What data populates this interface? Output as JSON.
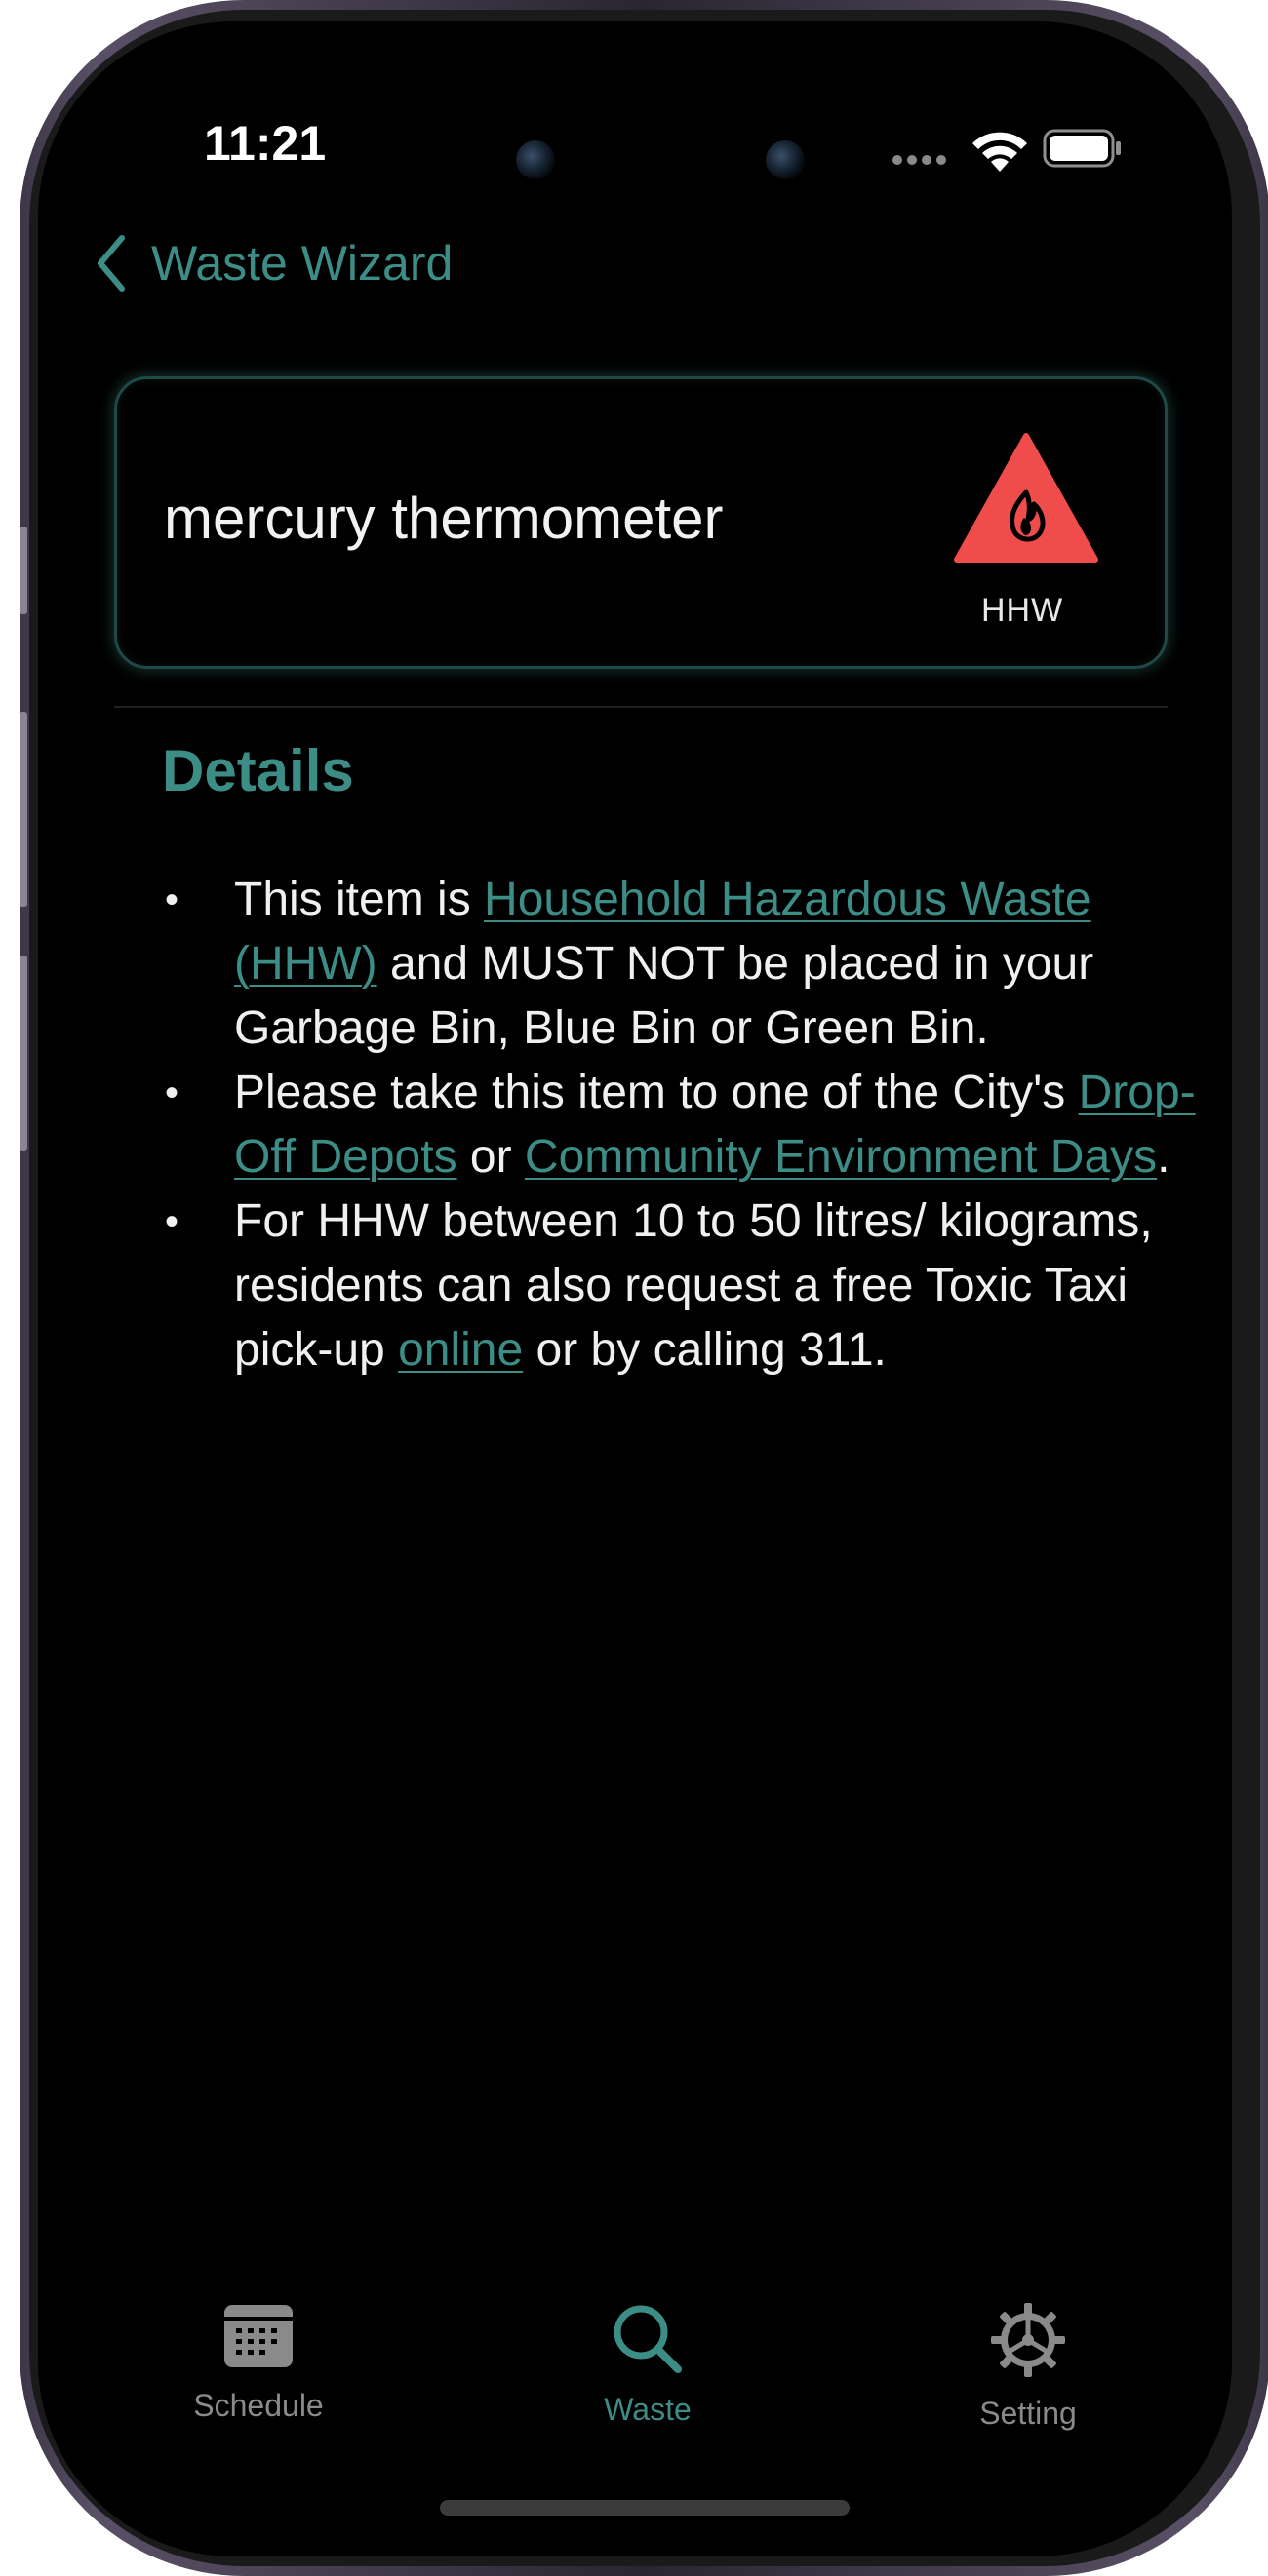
{
  "status_bar": {
    "time": "11:21"
  },
  "nav": {
    "back_label": "Waste Wizard"
  },
  "item": {
    "title": "mercury thermometer",
    "category_label": "HHW",
    "category_icon": "hazard-flame-icon",
    "category_color": "#f04c4c"
  },
  "details": {
    "heading": "Details",
    "bullet1": {
      "pre": "This item is ",
      "link": "Household Hazardous Waste (HHW)",
      "post": " and MUST NOT be placed in your Garbage Bin, Blue Bin or Green Bin."
    },
    "bullet2": {
      "pre": "Please take this item to one of the City's ",
      "link1": "Drop-Off Depots",
      "mid": " or ",
      "link2": "Community Environment Days",
      "post": "."
    },
    "bullet3": {
      "pre": "For HHW between 10 to 50 litres/ kilograms, residents can also request a free Toxic Taxi pick-up ",
      "link": "online",
      "post": " or by calling 311."
    }
  },
  "tabs": [
    {
      "label": "Schedule",
      "icon": "calendar-icon",
      "active": false
    },
    {
      "label": "Waste",
      "icon": "search-icon",
      "active": true
    },
    {
      "label": "Setting",
      "icon": "gear-icon",
      "active": false
    }
  ],
  "colors": {
    "accent": "#3d8d87",
    "background": "#000000",
    "inactive": "#8a8a8a"
  }
}
